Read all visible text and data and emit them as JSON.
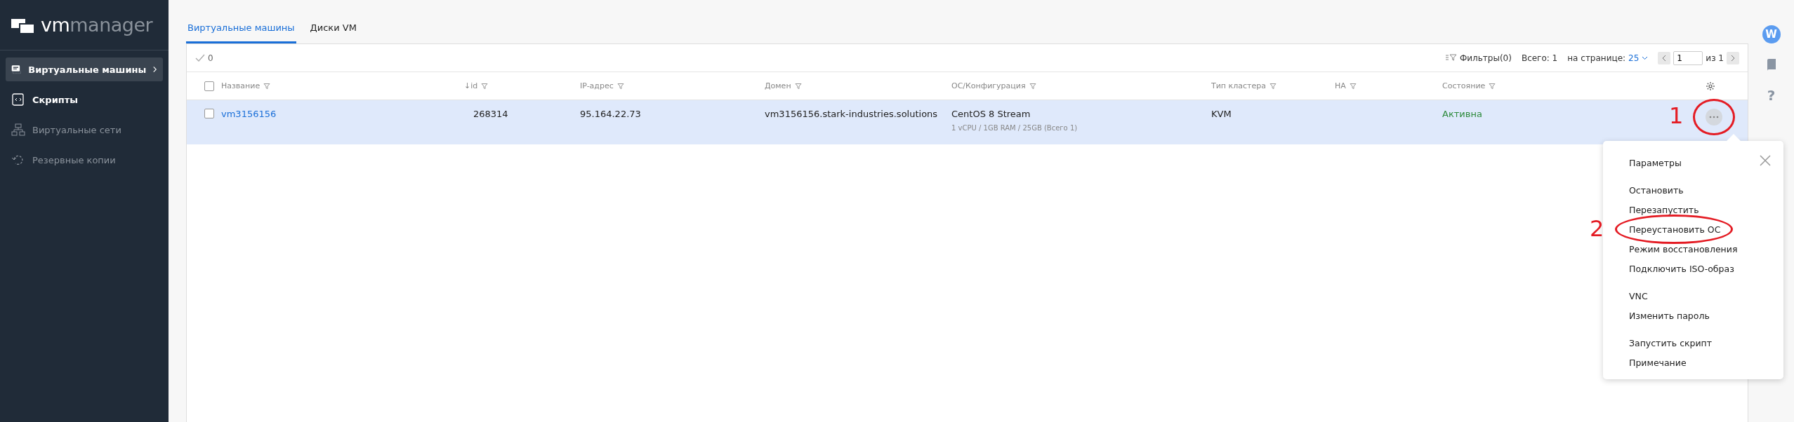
{
  "sidebar": {
    "logo": {
      "primary": "vm",
      "secondary": "manager"
    },
    "items": [
      {
        "label": "Виртуальные машины",
        "selected": true,
        "disabled": false
      },
      {
        "label": "Скрипты",
        "selected": false,
        "disabled": false
      },
      {
        "label": "Виртуальные сети",
        "selected": false,
        "disabled": true
      },
      {
        "label": "Резервные копии",
        "selected": false,
        "disabled": true
      }
    ]
  },
  "tabs": [
    {
      "label": "Виртуальные машины",
      "selected": true
    },
    {
      "label": "Диски VM",
      "selected": false
    }
  ],
  "toolbar": {
    "selected_count": "0",
    "filters": "Фильтры(0)",
    "total": "Всего: 1",
    "per_page_label": "на странице:",
    "per_page": "25",
    "page": "1",
    "page_of": "из 1"
  },
  "table": {
    "select_all": false,
    "columns": [
      "Название",
      "↓id",
      "IP-адрес",
      "Домен",
      "ОС/Конфигурация",
      "Тип кластера",
      "HA",
      "Состояние"
    ],
    "rows": [
      {
        "selected": false,
        "highlighted": true,
        "name": "vm3156156",
        "id": "268314",
        "ip": "95.164.22.73",
        "domain": "vm3156156.stark-industries.solutions",
        "os": "CentOS 8 Stream",
        "config": "1 vCPU / 1GB RAM / 25GB (Всего 1)",
        "cluster": "KVM",
        "state": {
          "text": "Активна",
          "kind": "active"
        },
        "annotation": "1"
      }
    ]
  },
  "menu": {
    "groups": [
      [
        {
          "label": "Параметры"
        }
      ],
      [
        {
          "label": "Остановить"
        },
        {
          "label": "Перезапустить"
        },
        {
          "label": "Переустановить ОС",
          "annotation": "2"
        },
        {
          "label": "Режим восстановления"
        },
        {
          "label": "Подключить ISO-образ"
        }
      ],
      [
        {
          "label": "VNC"
        },
        {
          "label": "Изменить пароль"
        }
      ],
      [
        {
          "label": "Запустить скрипт"
        },
        {
          "label": "Примечание"
        }
      ]
    ]
  },
  "rail": {
    "avatar": "W",
    "help": "?"
  }
}
